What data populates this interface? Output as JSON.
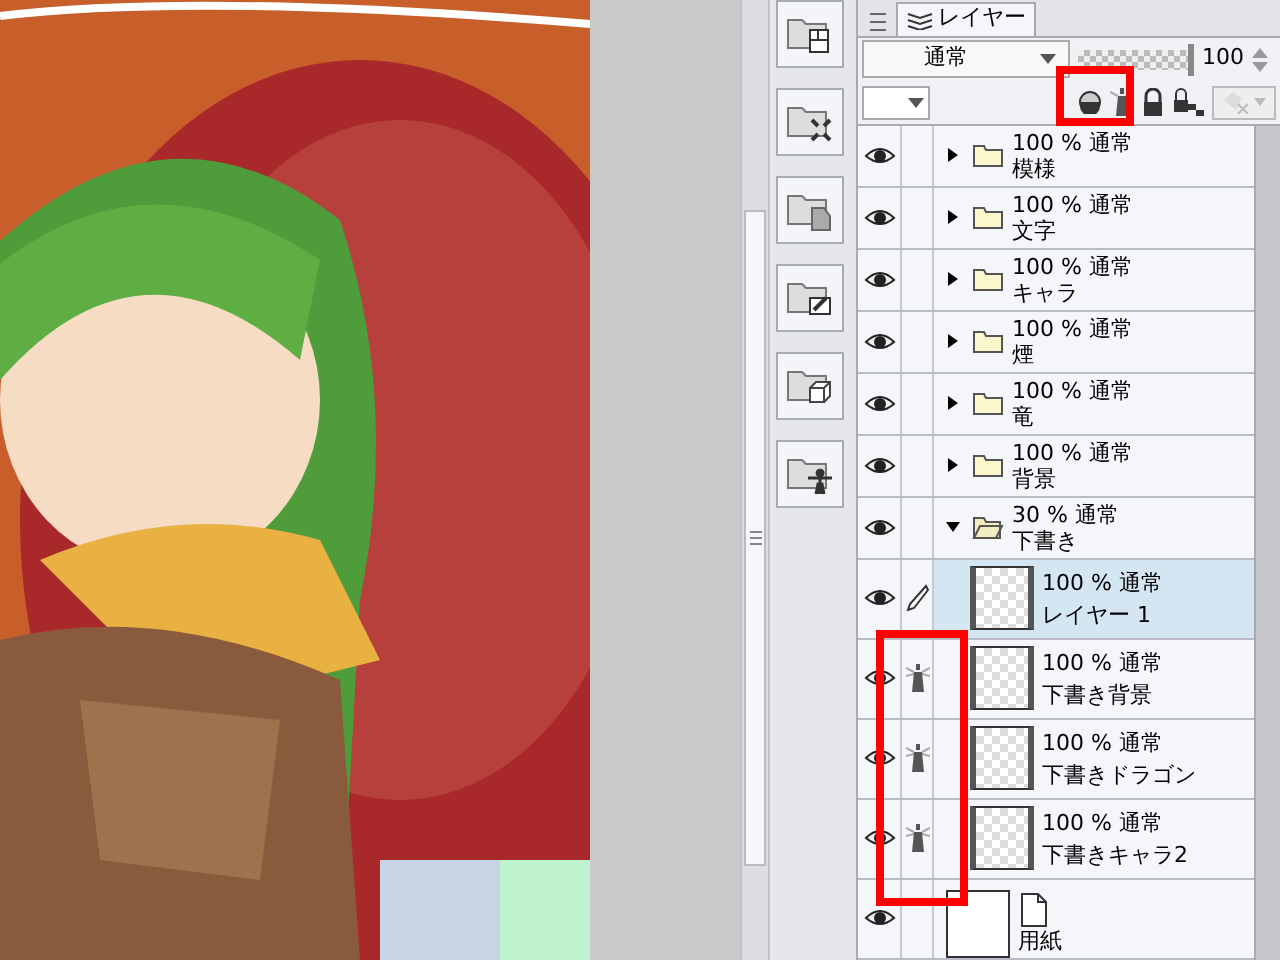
{
  "layer_panel": {
    "tab": "レイヤー",
    "blend_mode": "通常",
    "opacity": "100",
    "opacity_slider": {
      "level": 1
    },
    "layers": [
      {
        "kind": "folder",
        "info": "100 % 通常",
        "name": "模様",
        "visible": true,
        "expanded": false,
        "selected": false
      },
      {
        "kind": "folder",
        "info": "100 % 通常",
        "name": "文字",
        "visible": true,
        "expanded": false,
        "selected": false
      },
      {
        "kind": "folder",
        "info": "100 % 通常",
        "name": "キャラ",
        "visible": true,
        "expanded": false,
        "selected": false
      },
      {
        "kind": "folder",
        "info": "100 % 通常",
        "name": "煙",
        "visible": true,
        "expanded": false,
        "selected": false
      },
      {
        "kind": "folder",
        "info": "100 % 通常",
        "name": "竜",
        "visible": true,
        "expanded": false,
        "selected": false
      },
      {
        "kind": "folder",
        "info": "100 % 通常",
        "name": "背景",
        "visible": true,
        "expanded": false,
        "selected": false
      },
      {
        "kind": "folder",
        "info": "30 % 通常",
        "name": "下書き",
        "visible": true,
        "expanded": true,
        "selected": false,
        "children": [
          {
            "kind": "raster",
            "info": "100 % 通常",
            "name": "レイヤー 1",
            "visible": true,
            "selected": true,
            "draft": false
          },
          {
            "kind": "raster",
            "info": "100 % 通常",
            "name": "下書き背景",
            "visible": true,
            "selected": false,
            "draft": true
          },
          {
            "kind": "raster",
            "info": "100 % 通常",
            "name": "下書きドラゴン",
            "visible": true,
            "selected": false,
            "draft": true
          },
          {
            "kind": "raster",
            "info": "100 % 通常",
            "name": "下書きキャラ2",
            "visible": true,
            "selected": false,
            "draft": true
          }
        ]
      },
      {
        "kind": "paper",
        "name": "用紙",
        "visible": true,
        "selected": false
      }
    ]
  }
}
